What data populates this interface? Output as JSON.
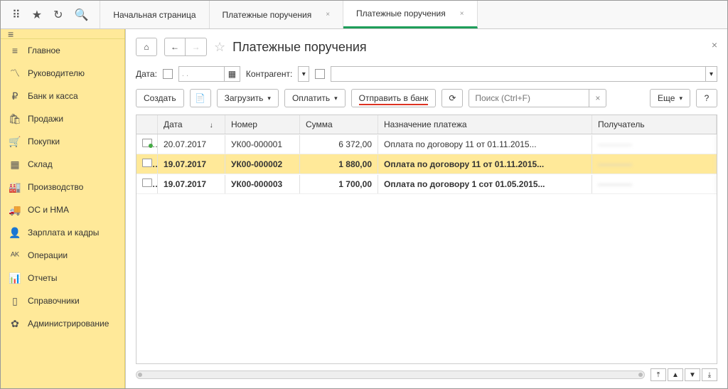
{
  "tabs": {
    "home": "Начальная страница",
    "t1": "Платежные поручения",
    "t2": "Платежные поручения"
  },
  "sidebar": [
    {
      "icon": "≡",
      "label": "Главное"
    },
    {
      "icon": "〽",
      "label": "Руководителю"
    },
    {
      "icon": "₽",
      "label": "Банк и касса"
    },
    {
      "icon": "🛍",
      "label": "Продажи"
    },
    {
      "icon": "🛒",
      "label": "Покупки"
    },
    {
      "icon": "▦",
      "label": "Склад"
    },
    {
      "icon": "🏭",
      "label": "Производство"
    },
    {
      "icon": "🚚",
      "label": "ОС и НМА"
    },
    {
      "icon": "👤",
      "label": "Зарплата и кадры"
    },
    {
      "icon": "ᴬᴷ",
      "label": "Операции"
    },
    {
      "icon": "📊",
      "label": "Отчеты"
    },
    {
      "icon": "▯",
      "label": "Справочники"
    },
    {
      "icon": "✿",
      "label": "Администрирование"
    }
  ],
  "page": {
    "title": "Платежные поручения"
  },
  "filter": {
    "date_label": "Дата:",
    "date_value": ". .",
    "kontragent_label": "Контрагент:"
  },
  "toolbar": {
    "create": "Создать",
    "load": "Загрузить",
    "pay": "Оплатить",
    "send": "Отправить в банк",
    "more": "Еще",
    "help": "?",
    "search_placeholder": "Поиск (Ctrl+F)"
  },
  "columns": {
    "date": "Дата",
    "number": "Номер",
    "sum": "Сумма",
    "purpose": "Назначение платежа",
    "recipient": "Получатель"
  },
  "rows": [
    {
      "date": "20.07.2017",
      "number": "УК00-000001",
      "sum": "6 372,00",
      "purpose": "Оплата по договору 11 от 01.11.2015...",
      "recipient": "————",
      "bold": false,
      "selected": false,
      "green": true
    },
    {
      "date": "19.07.2017",
      "number": "УК00-000002",
      "sum": "1 880,00",
      "purpose": "Оплата по договору 11 от 01.11.2015...",
      "recipient": "————",
      "bold": true,
      "selected": true,
      "green": false
    },
    {
      "date": "19.07.2017",
      "number": "УК00-000003",
      "sum": "1 700,00",
      "purpose": "Оплата по договору 1 сот 01.05.2015...",
      "recipient": "————",
      "bold": true,
      "selected": false,
      "green": false
    }
  ]
}
